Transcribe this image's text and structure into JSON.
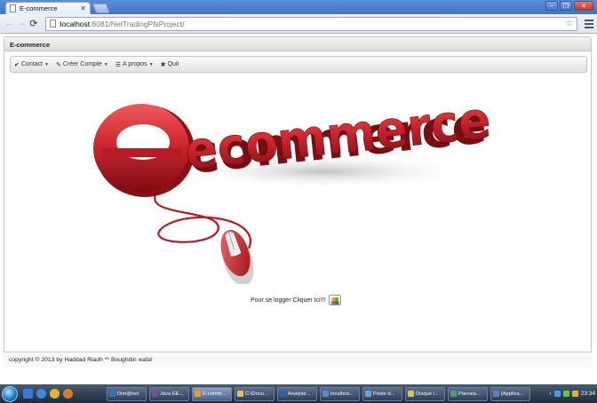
{
  "browser": {
    "tab_title": "E-commerce",
    "url_host": "localhost",
    "url_rest": ":8081/NetTradingPfsProject/"
  },
  "page": {
    "panel_title": "E-commerce",
    "nav": [
      {
        "label": "Contact",
        "icon": "check-icon"
      },
      {
        "label": "Créer Compte",
        "icon": "pencil-icon"
      },
      {
        "label": "A propos",
        "icon": "list-icon"
      },
      {
        "label": "Quit",
        "icon": "close-icon"
      }
    ],
    "hero_text": "ecommerce",
    "login_text": "Pour se logger Cliquer Ici!!!",
    "footer": "copyright © 2013 by Haddad Riadh ** Boughdiri wafa!"
  },
  "taskbar": {
    "tasks": [
      {
        "label": "Dim@net",
        "color": "#2c73c8"
      },
      {
        "label": "Java EE...",
        "color": "#7b4fa0"
      },
      {
        "label": "E-comm...",
        "color": "#e5a01f",
        "active": true
      },
      {
        "label": "C:\\Docu...",
        "color": "#e3c050"
      },
      {
        "label": "Analyse...",
        "color": "#2d5fb0"
      },
      {
        "label": "localhos...",
        "color": "#4d8fd6"
      },
      {
        "label": "Poste d...",
        "color": "#6ca0e0"
      },
      {
        "label": "Disque l...",
        "color": "#d9c05a"
      },
      {
        "label": "Pannea...",
        "color": "#4aa070"
      },
      {
        "label": "[Applica...",
        "color": "#5a82c0"
      }
    ],
    "time": "23:34"
  },
  "colors": {
    "accent_red": "#c8232c",
    "chrome_blue": "#3f74c7"
  }
}
